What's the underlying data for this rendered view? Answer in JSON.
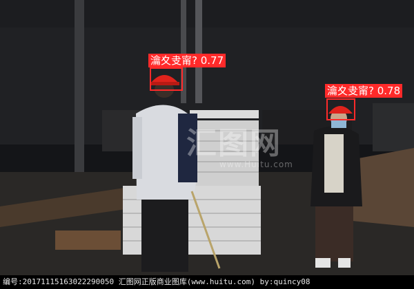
{
  "detections": [
    {
      "label": "瀹夊叏甯?",
      "score": "0.77"
    },
    {
      "label": "瀹夊叏甯?",
      "score": "0.78"
    }
  ],
  "watermark": {
    "text": "汇图网",
    "url": "www.Huitu.com"
  },
  "footer": {
    "id_label": "编号:",
    "id_value": "20171115163022290050",
    "site_text": "汇图网正版商业图库(www.huitu.com)",
    "author": "by:quincy08"
  },
  "colors": {
    "box": "#ff2a2a",
    "helmet": "#e0231c"
  }
}
